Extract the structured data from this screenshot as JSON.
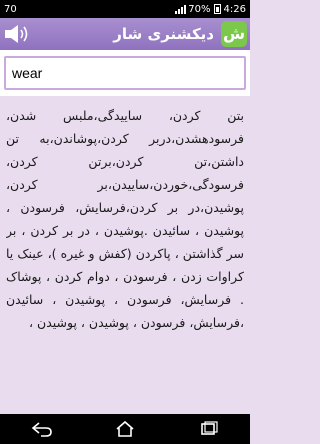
{
  "status_bar": {
    "notification": "70",
    "battery_percent": "70%",
    "time": "4:26"
  },
  "header": {
    "title": "دیکشنری شار",
    "logo_letter": "ش",
    "speaker_icon": "speaker-icon"
  },
  "search": {
    "value": "wear",
    "placeholder": ""
  },
  "result": {
    "text": "بتن کردن، ساییدگی،ملبس شدن، فرسودهشدن،دربر کردن،پوشاندن،به تن داشتن،تن کردن،برتن کردن، فرسودگی،خوردن،ساییدن،بر کردن، پوشیدن،در بر کردن،فرسایش، فرسودن ، پوشیدن ، سائیدن .پوشیدن ، در بر کردن ، بر سر گذاشتن ، پاکردن (کفش و غیره )، عینک یا کراوات زدن ، فرسودن ، دوام کردن ، پوشاک . فرسایش، فرسودن ، پوشیدن ، سائیدن ،فرسایش، فرسودن ، پوشیدن ، پوشیدن ،"
  },
  "nav_bar": {
    "icons": [
      "back-icon",
      "home-icon",
      "recent-apps-icon"
    ]
  }
}
